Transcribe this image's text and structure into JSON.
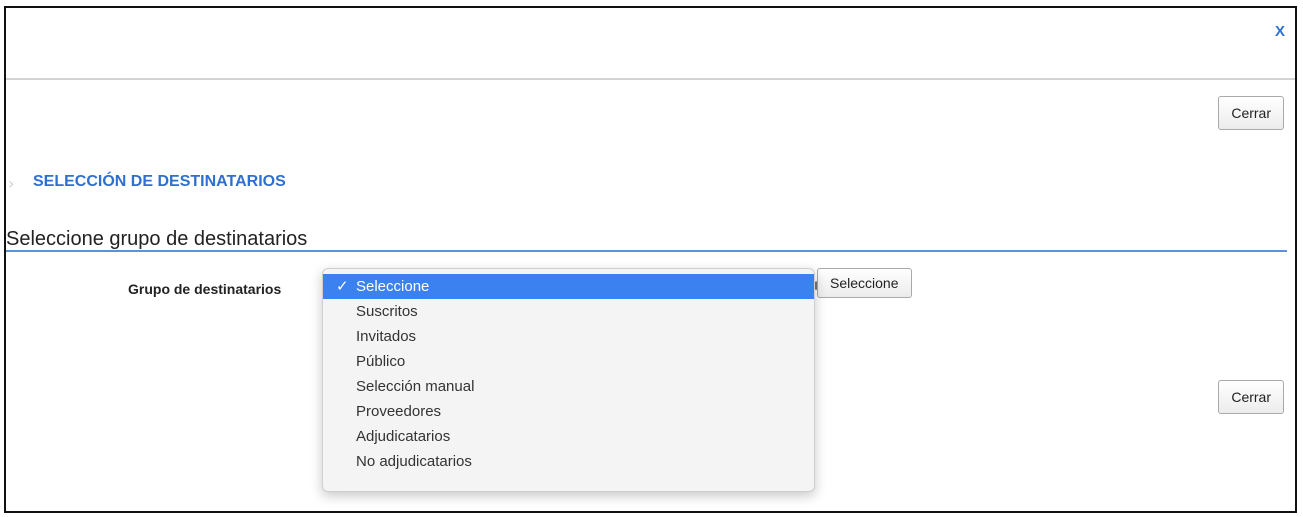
{
  "dialog": {
    "close_icon": "X",
    "close_top_label": "Cerrar",
    "close_bottom_label": "Cerrar"
  },
  "section": {
    "arrow_icon": "chevron-right-icon",
    "title": "SELECCIÓN DE DESTINATARIOS",
    "subheading": "Seleccione grupo de destinatarios"
  },
  "form": {
    "field_label": "Grupo de destinatarios",
    "select_button_label": "Seleccione",
    "dropdown": {
      "selected": "Seleccione",
      "check_icon": "✓",
      "options": [
        "Seleccione",
        "Suscritos",
        "Invitados",
        "Público",
        "Selección manual",
        "Proveedores",
        "Adjudicatarios",
        "No adjudicatarios"
      ]
    }
  },
  "colors": {
    "accent": "#2f6fcf",
    "selection": "#3b82f0",
    "divider": "#5d92d6"
  }
}
